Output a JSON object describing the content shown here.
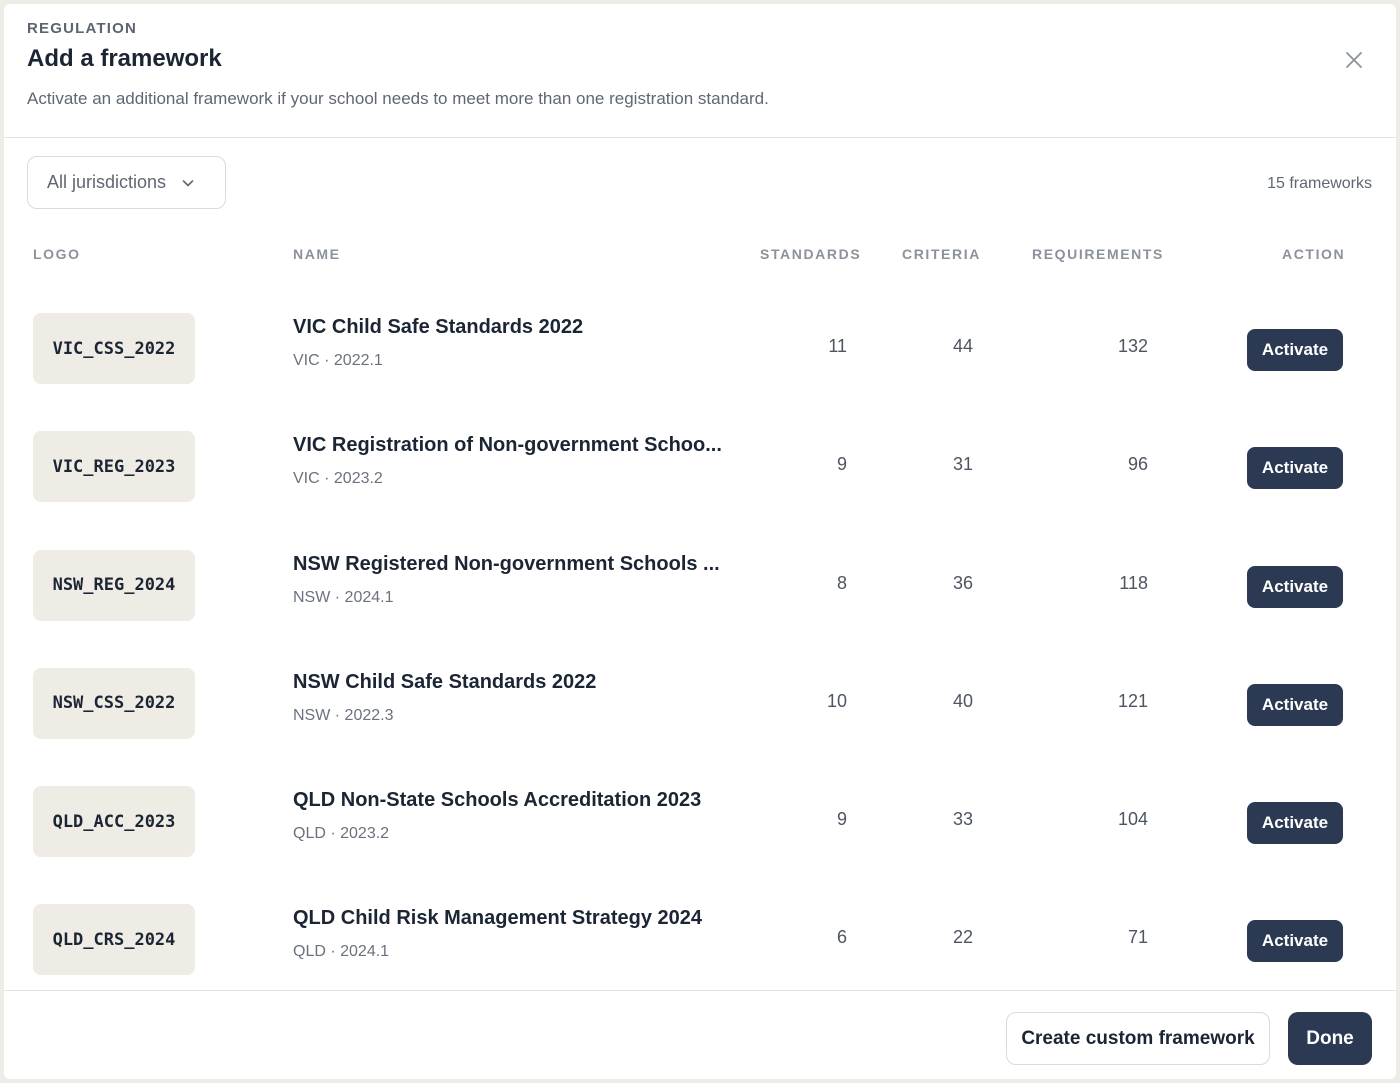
{
  "header": {
    "eyebrow": "REGULATION",
    "title": "Add a framework",
    "subtitle": "Activate an additional framework if your school needs to meet more than one registration standard.",
    "close_icon": "close-icon"
  },
  "filter": {
    "selected": "All jurisdictions",
    "icon": "chevron-down-icon"
  },
  "count_label": "15 frameworks",
  "columns": {
    "logo": "LOGO",
    "name": "NAME",
    "standards": "STANDARDS",
    "criteria": "CRITERIA",
    "requirements": "REQUIREMENTS",
    "action": "ACTION"
  },
  "rows": [
    {
      "logo": "VIC_CSS_2022",
      "name": "VIC Child Safe Standards 2022",
      "meta": "VIC · 2022.1",
      "standards": "11",
      "criteria": "44",
      "requirements": "132",
      "action": "Activate"
    },
    {
      "logo": "VIC_REG_2023",
      "name": "VIC Registration of Non-government Schoo...",
      "meta": "VIC · 2023.2",
      "standards": "9",
      "criteria": "31",
      "requirements": "96",
      "action": "Activate"
    },
    {
      "logo": "NSW_REG_2024",
      "name": "NSW Registered Non-government Schools ...",
      "meta": "NSW · 2024.1",
      "standards": "8",
      "criteria": "36",
      "requirements": "118",
      "action": "Activate"
    },
    {
      "logo": "NSW_CSS_2022",
      "name": "NSW Child Safe Standards 2022",
      "meta": "NSW · 2022.3",
      "standards": "10",
      "criteria": "40",
      "requirements": "121",
      "action": "Activate"
    },
    {
      "logo": "QLD_ACC_2023",
      "name": "QLD Non-State Schools Accreditation 2023",
      "meta": "QLD · 2023.2",
      "standards": "9",
      "criteria": "33",
      "requirements": "104",
      "action": "Activate"
    },
    {
      "logo": "QLD_CRS_2024",
      "name": "QLD Child Risk Management Strategy 2024",
      "meta": "QLD · 2024.1",
      "standards": "6",
      "criteria": "22",
      "requirements": "71",
      "action": "Activate"
    }
  ],
  "footer": {
    "secondary_label": "Create custom framework",
    "primary_label": "Done"
  }
}
